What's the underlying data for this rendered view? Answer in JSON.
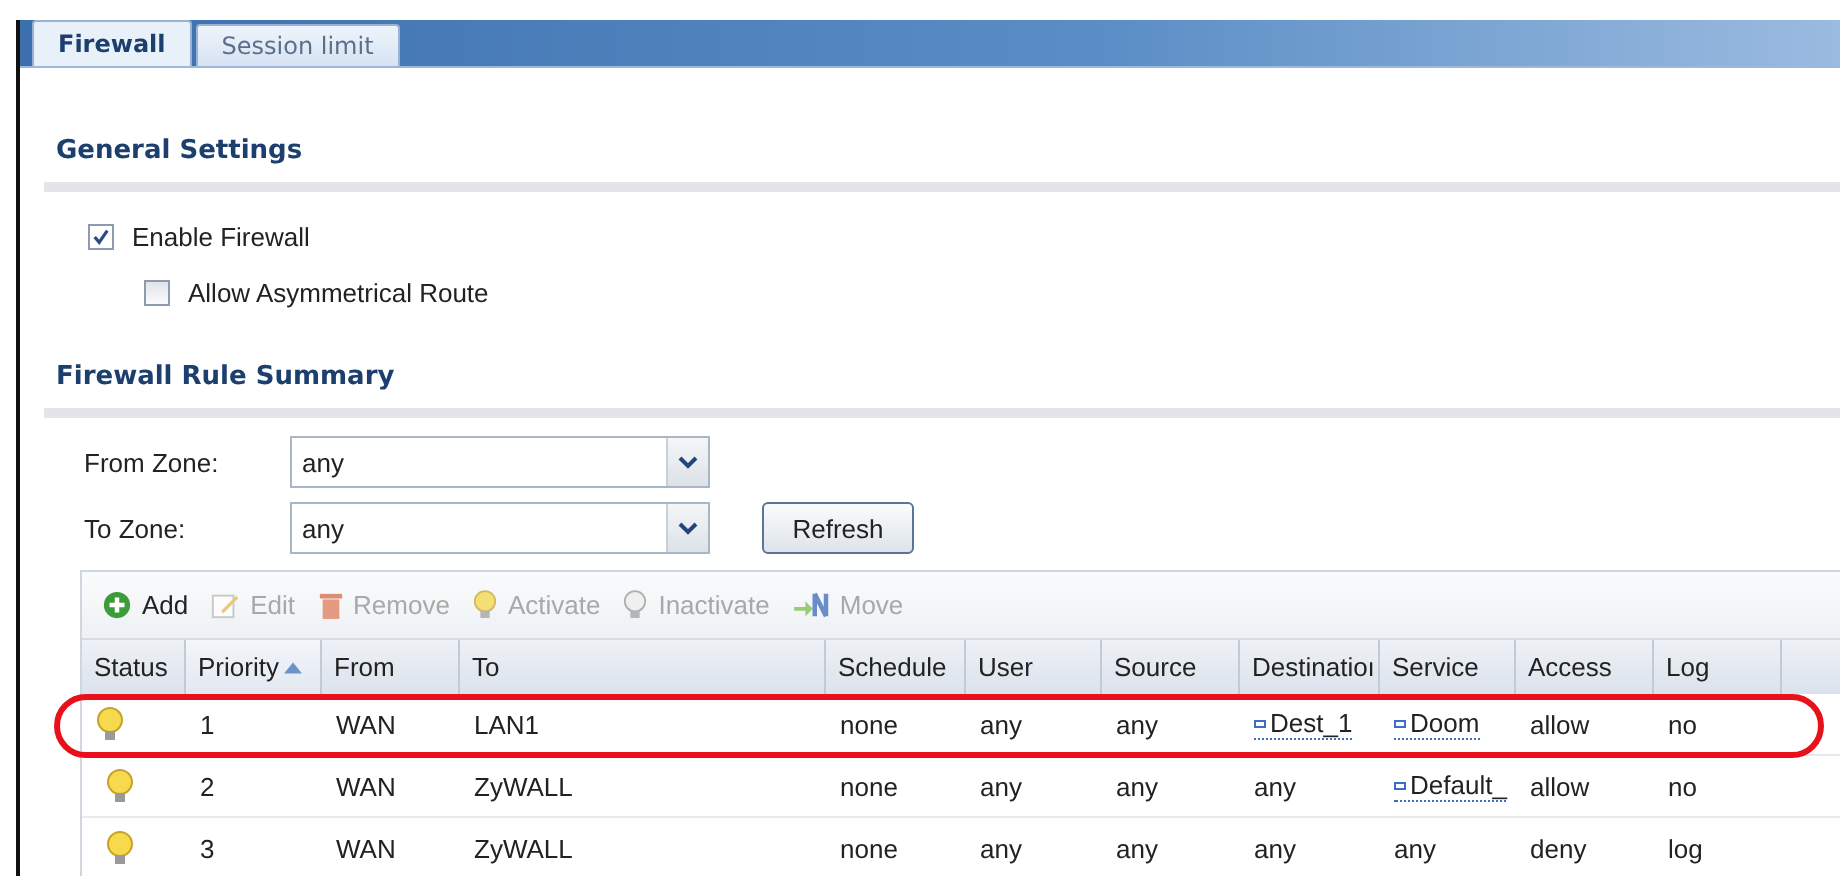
{
  "tabs": [
    {
      "label": "Firewall",
      "selected": true
    },
    {
      "label": "Session limit",
      "selected": false
    }
  ],
  "general_settings": {
    "title": "General Settings",
    "options": [
      {
        "label": "Enable Firewall",
        "checked": true,
        "children": [
          {
            "label": "Allow Asymmetrical Route",
            "checked": false
          }
        ]
      }
    ]
  },
  "rule_summary": {
    "title": "Firewall Rule Summary",
    "filters": [
      {
        "label": "From Zone:",
        "value": "any"
      },
      {
        "label": "To Zone:",
        "value": "any"
      }
    ],
    "refresh_button": "Refresh",
    "toolbar": [
      {
        "kind": "add",
        "label": "Add",
        "disabled": false
      },
      {
        "kind": "edit",
        "label": "Edit",
        "disabled": true
      },
      {
        "kind": "remove",
        "label": "Remove",
        "disabled": true
      },
      {
        "kind": "activate",
        "label": "Activate",
        "disabled": true
      },
      {
        "kind": "inactivate",
        "label": "Inactivate",
        "disabled": true
      },
      {
        "kind": "move",
        "label": "Move",
        "disabled": true
      }
    ],
    "columns": [
      {
        "label": "Status",
        "sorted": false
      },
      {
        "label": "Priority",
        "sorted": true
      },
      {
        "label": "From",
        "sorted": false
      },
      {
        "label": "To",
        "sorted": false
      },
      {
        "label": "Schedule",
        "sorted": false
      },
      {
        "label": "User",
        "sorted": false
      },
      {
        "label": "Source",
        "sorted": false
      },
      {
        "label": "Destinatioı",
        "sorted": false
      },
      {
        "label": "Service",
        "sorted": false
      },
      {
        "label": "Access",
        "sorted": false
      },
      {
        "label": "Log",
        "sorted": false
      }
    ],
    "rows": [
      {
        "highlighted": true,
        "cells": [
          {
            "kind": "status",
            "active": true
          },
          {
            "kind": "text",
            "text": "1"
          },
          {
            "kind": "text",
            "text": "WAN"
          },
          {
            "kind": "text",
            "text": "LAN1"
          },
          {
            "kind": "text",
            "text": "none"
          },
          {
            "kind": "text",
            "text": "any"
          },
          {
            "kind": "text",
            "text": "any"
          },
          {
            "kind": "object",
            "text": "Dest_1"
          },
          {
            "kind": "object",
            "text": "Doom"
          },
          {
            "kind": "text",
            "text": "allow"
          },
          {
            "kind": "text",
            "text": "no"
          }
        ]
      },
      {
        "highlighted": false,
        "cells": [
          {
            "kind": "status",
            "active": true
          },
          {
            "kind": "text",
            "text": "2"
          },
          {
            "kind": "text",
            "text": "WAN"
          },
          {
            "kind": "text",
            "text": "ZyWALL"
          },
          {
            "kind": "text",
            "text": "none"
          },
          {
            "kind": "text",
            "text": "any"
          },
          {
            "kind": "text",
            "text": "any"
          },
          {
            "kind": "text",
            "text": "any"
          },
          {
            "kind": "object",
            "text": "Default_"
          },
          {
            "kind": "text",
            "text": "allow"
          },
          {
            "kind": "text",
            "text": "no"
          }
        ]
      },
      {
        "highlighted": false,
        "cells": [
          {
            "kind": "status",
            "active": true
          },
          {
            "kind": "text",
            "text": "3"
          },
          {
            "kind": "text",
            "text": "WAN"
          },
          {
            "kind": "text",
            "text": "ZyWALL"
          },
          {
            "kind": "text",
            "text": "none"
          },
          {
            "kind": "text",
            "text": "any"
          },
          {
            "kind": "text",
            "text": "any"
          },
          {
            "kind": "text",
            "text": "any"
          },
          {
            "kind": "text",
            "text": "any"
          },
          {
            "kind": "text",
            "text": "deny"
          },
          {
            "kind": "text",
            "text": "log"
          }
        ]
      }
    ]
  }
}
